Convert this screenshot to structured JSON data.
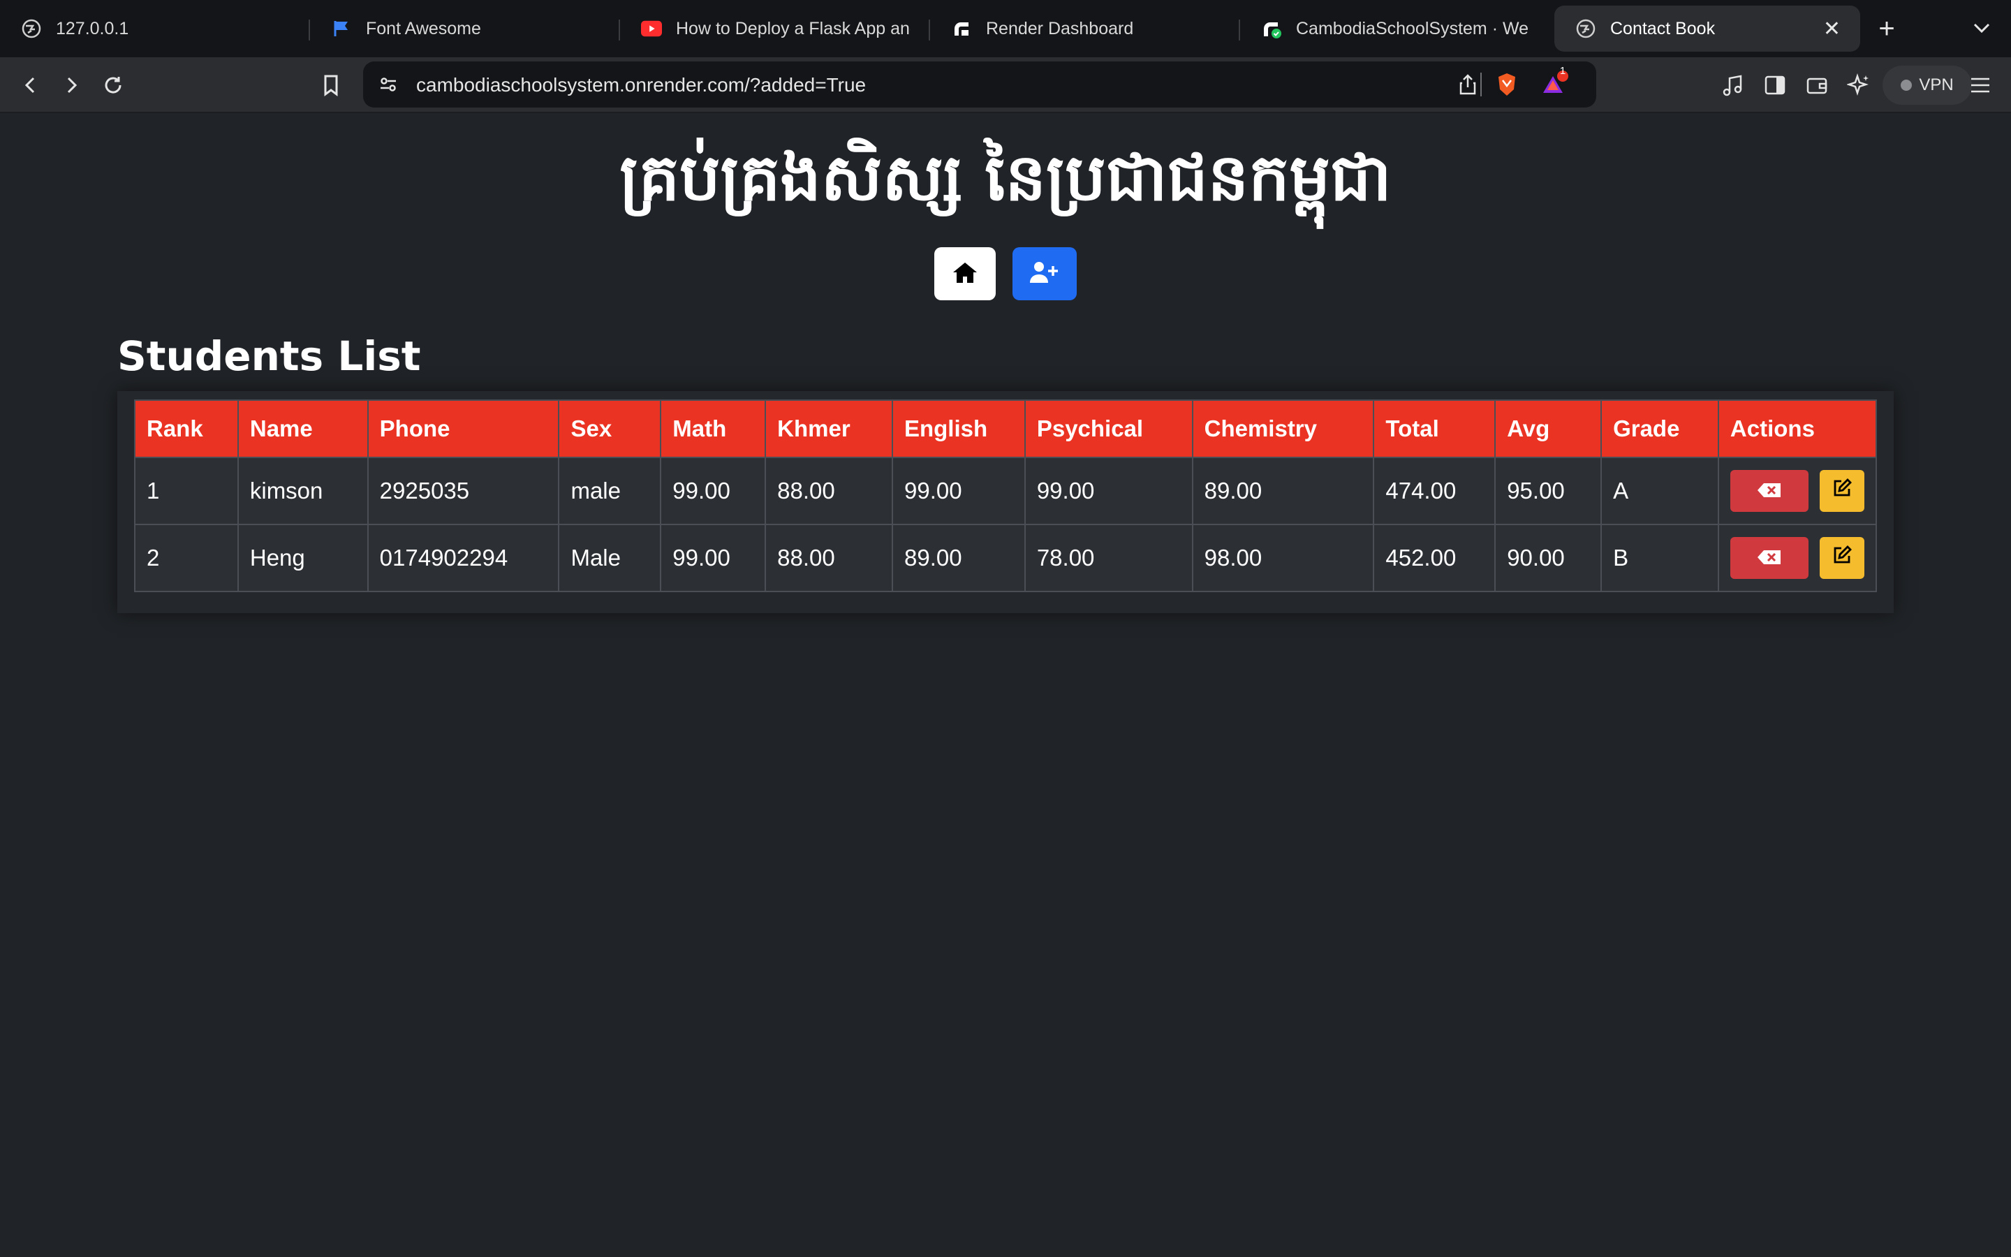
{
  "browser": {
    "tabs": [
      {
        "title": "127.0.0.1",
        "icon": "globe-icon"
      },
      {
        "title": "Font Awesome",
        "icon": "flag-icon"
      },
      {
        "title": "How to Deploy a Flask App and",
        "icon": "youtube-icon"
      },
      {
        "title": "Render Dashboard",
        "icon": "render-icon"
      },
      {
        "title": "CambodiaSchoolSystem · We",
        "icon": "render-icon"
      },
      {
        "title": "Contact Book",
        "icon": "globe-icon",
        "active": true
      }
    ],
    "new_tab": "+",
    "url": "cambodiaschoolsystem.onrender.com/?added=True",
    "vpn_label": "VPN",
    "notification_count": "1"
  },
  "page": {
    "title": "គ្រប់គ្រងសិស្ស នៃប្រជាជនកម្ពុជា",
    "home_button": "home-icon",
    "add_button": "user-plus-icon",
    "section_title": "Students List"
  },
  "table": {
    "headers": [
      "Rank",
      "Name",
      "Phone",
      "Sex",
      "Math",
      "Khmer",
      "English",
      "Psychical",
      "Chemistry",
      "Total",
      "Avg",
      "Grade",
      "Actions"
    ],
    "rows": [
      [
        "1",
        "kimson",
        "2925035",
        "male",
        "99.00",
        "88.00",
        "99.00",
        "99.00",
        "89.00",
        "474.00",
        "95.00",
        "A"
      ],
      [
        "2",
        "Heng",
        "0174902294",
        "Male",
        "99.00",
        "88.00",
        "89.00",
        "78.00",
        "98.00",
        "452.00",
        "90.00",
        "B"
      ]
    ]
  },
  "colors": {
    "header_red": "#ea3323",
    "add_blue": "#1f6cf2",
    "delete_red": "#d0393e",
    "edit_yellow": "#f5bd2e",
    "background": "#202327"
  }
}
